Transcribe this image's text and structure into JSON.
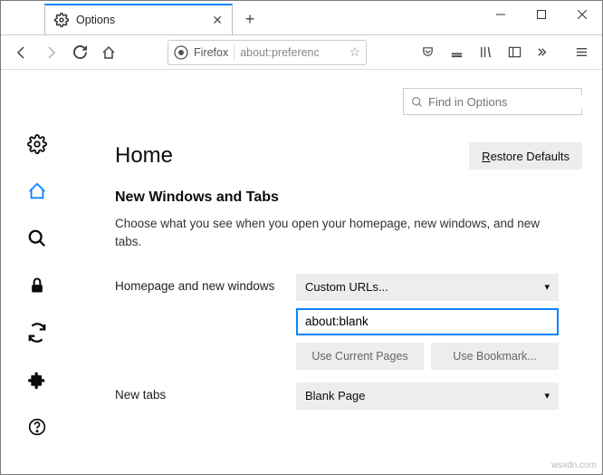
{
  "tab": {
    "title": "Options"
  },
  "urlbar": {
    "brand": "Firefox",
    "address": "about:preferenc"
  },
  "find": {
    "placeholder": "Find in Options"
  },
  "page": {
    "title": "Home",
    "restore": "Restore Defaults",
    "section_heading": "New Windows and Tabs",
    "section_desc": "Choose what you see when you open your homepage, new windows, and new tabs."
  },
  "homepage": {
    "label": "Homepage and new windows",
    "select_value": "Custom URLs...",
    "url_value": "about:blank",
    "btn_current": "Use Current Pages",
    "btn_bookmark": "Use Bookmark..."
  },
  "newtabs": {
    "label": "New tabs",
    "select_value": "Blank Page"
  },
  "attribution": "wsxdn.com"
}
